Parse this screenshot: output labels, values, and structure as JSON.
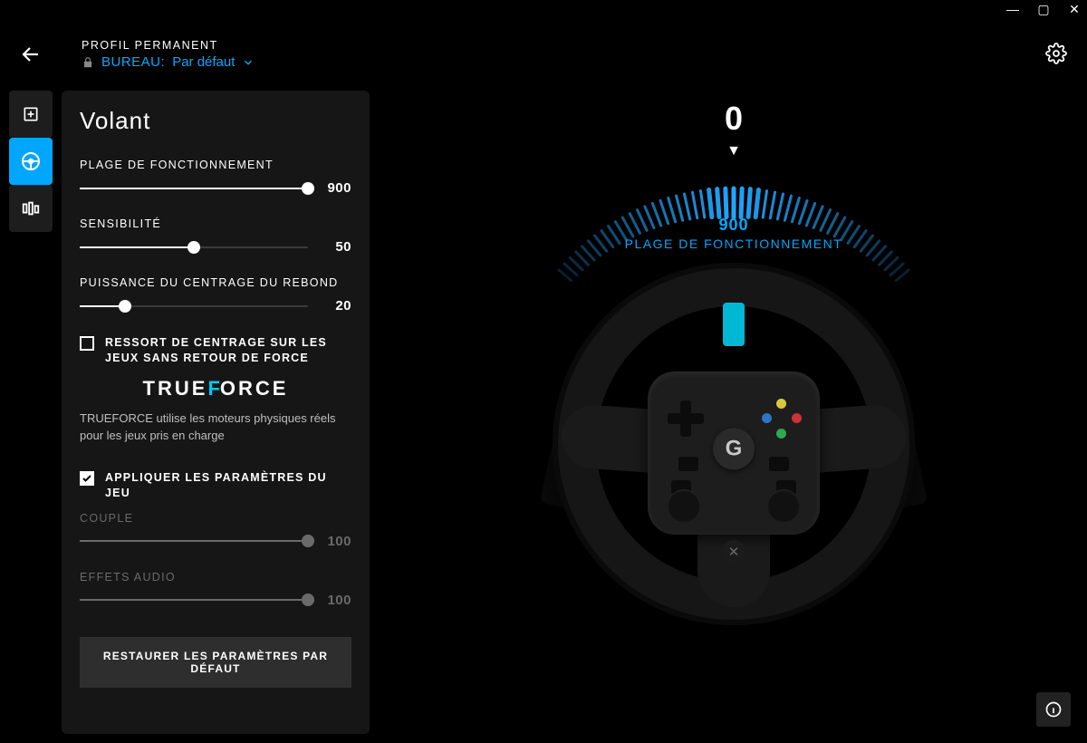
{
  "header": {
    "profile_label": "PROFIL PERMANENT",
    "profile_context": "BUREAU:",
    "profile_value": "Par défaut"
  },
  "panel": {
    "title": "Volant",
    "sliders": {
      "operating_range": {
        "label": "PLAGE DE FONCTIONNEMENT",
        "value": "900",
        "pct": 100,
        "dim": false
      },
      "sensitivity": {
        "label": "SENSIBILITÉ",
        "value": "50",
        "pct": 50,
        "dim": false
      },
      "centering": {
        "label": "PUISSANCE DU CENTRAGE DU REBOND",
        "value": "20",
        "pct": 20,
        "dim": false
      },
      "torque": {
        "label": "COUPLE",
        "value": "100",
        "pct": 100,
        "dim": true
      },
      "audio": {
        "label": "EFFETS AUDIO",
        "value": "100",
        "pct": 100,
        "dim": true
      }
    },
    "checkboxes": {
      "centering_spring": {
        "label": "RESSORT DE CENTRAGE SUR LES JEUX SANS RETOUR DE FORCE",
        "checked": false
      },
      "apply_game": {
        "label": "APPLIQUER LES PARAMÈTRES DU JEU",
        "checked": true
      }
    },
    "trueforce": {
      "brand_pre": "TRUE",
      "brand_post": "ORCE",
      "description": "TRUEFORCE utilise les moteurs physiques réels pour les jeux pris en charge"
    },
    "restore_button": "RESTAURER LES PARAMÈTRES PAR DÉFAUT"
  },
  "viz": {
    "angle": "0",
    "gauge_value": "900",
    "gauge_label": "PLAGE DE FONCTIONNEMENT"
  },
  "colors": {
    "accent": "#00aaff"
  }
}
